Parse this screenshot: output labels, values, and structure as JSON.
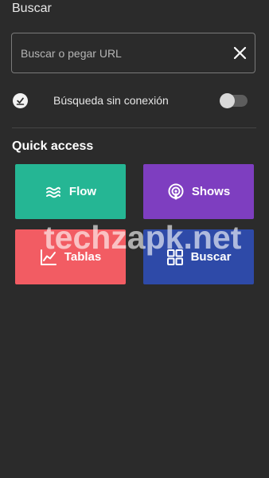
{
  "header": {
    "title": "Buscar"
  },
  "search": {
    "placeholder": "Buscar o pegar URL",
    "value": "",
    "clear_icon": "close-icon"
  },
  "offline": {
    "label": "Búsqueda sin conexión",
    "icon": "offline-download-icon",
    "toggle_on": false
  },
  "quick_access": {
    "title": "Quick access",
    "tiles": [
      {
        "label": "Flow",
        "icon": "waves-icon",
        "color": "#25b694"
      },
      {
        "label": "Shows",
        "icon": "podcast-icon",
        "color": "#7e3ec0"
      },
      {
        "label": "Tablas",
        "icon": "chart-icon",
        "color": "#f25c63"
      },
      {
        "label": "Buscar",
        "icon": "grid-icon",
        "color": "#2e4aa8"
      }
    ]
  },
  "watermark": {
    "text": "techzapk.net"
  },
  "colors": {
    "background": "#2b2b2b",
    "border": "#7a7a7a",
    "toggle_track": "#5d5d5d"
  }
}
